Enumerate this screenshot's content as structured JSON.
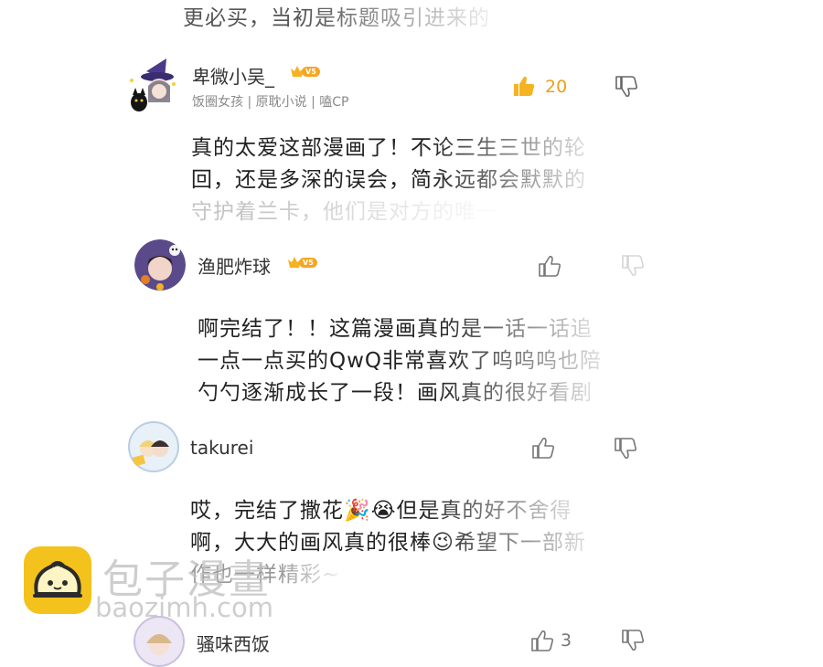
{
  "top_partial_text": "更必买，当初是标题吸引进来的",
  "comments": [
    {
      "username": "卑微小吴_",
      "vip_level": "V5",
      "tags": "饭圈女孩 | 原耽小说 | 嗑CP",
      "likes": "20",
      "liked": true,
      "lines": [
        "真的太爱这部漫画了！不论三生三世的轮",
        "回，还是多深的误会，简永远都会默默的",
        "守护着兰卡，他们是对方的唯一"
      ],
      "avatar_icon": "witch-with-cat-avatar"
    },
    {
      "username": "渔肥炸球",
      "vip_level": "V5",
      "likes": "",
      "liked": false,
      "lines": [
        "啊完结了！！这篇漫画真的是一话一话追",
        "一点一点买的QwQ非常喜欢了呜呜呜也陪",
        "勺勺逐渐成长了一段！画风真的很好看剧"
      ],
      "avatar_icon": "halloween-avatar"
    },
    {
      "username": "takurei",
      "likes": "",
      "liked": false,
      "lines": [
        "哎，完结了撒花🎉😭但是真的好不舍得",
        "啊，大大的画风真的很棒😉希望下一部新",
        "作也一样精彩~"
      ],
      "avatar_icon": "couple-avatar"
    },
    {
      "username": "骚味西饭",
      "likes": "3",
      "liked": false,
      "avatar_icon": "anime-girl-avatar"
    }
  ],
  "watermark": {
    "text": "包子漫畫",
    "url": "baozimh.com"
  },
  "colors": {
    "accent": "#f5b321",
    "text": "#222222",
    "muted": "#8a8a8a"
  }
}
